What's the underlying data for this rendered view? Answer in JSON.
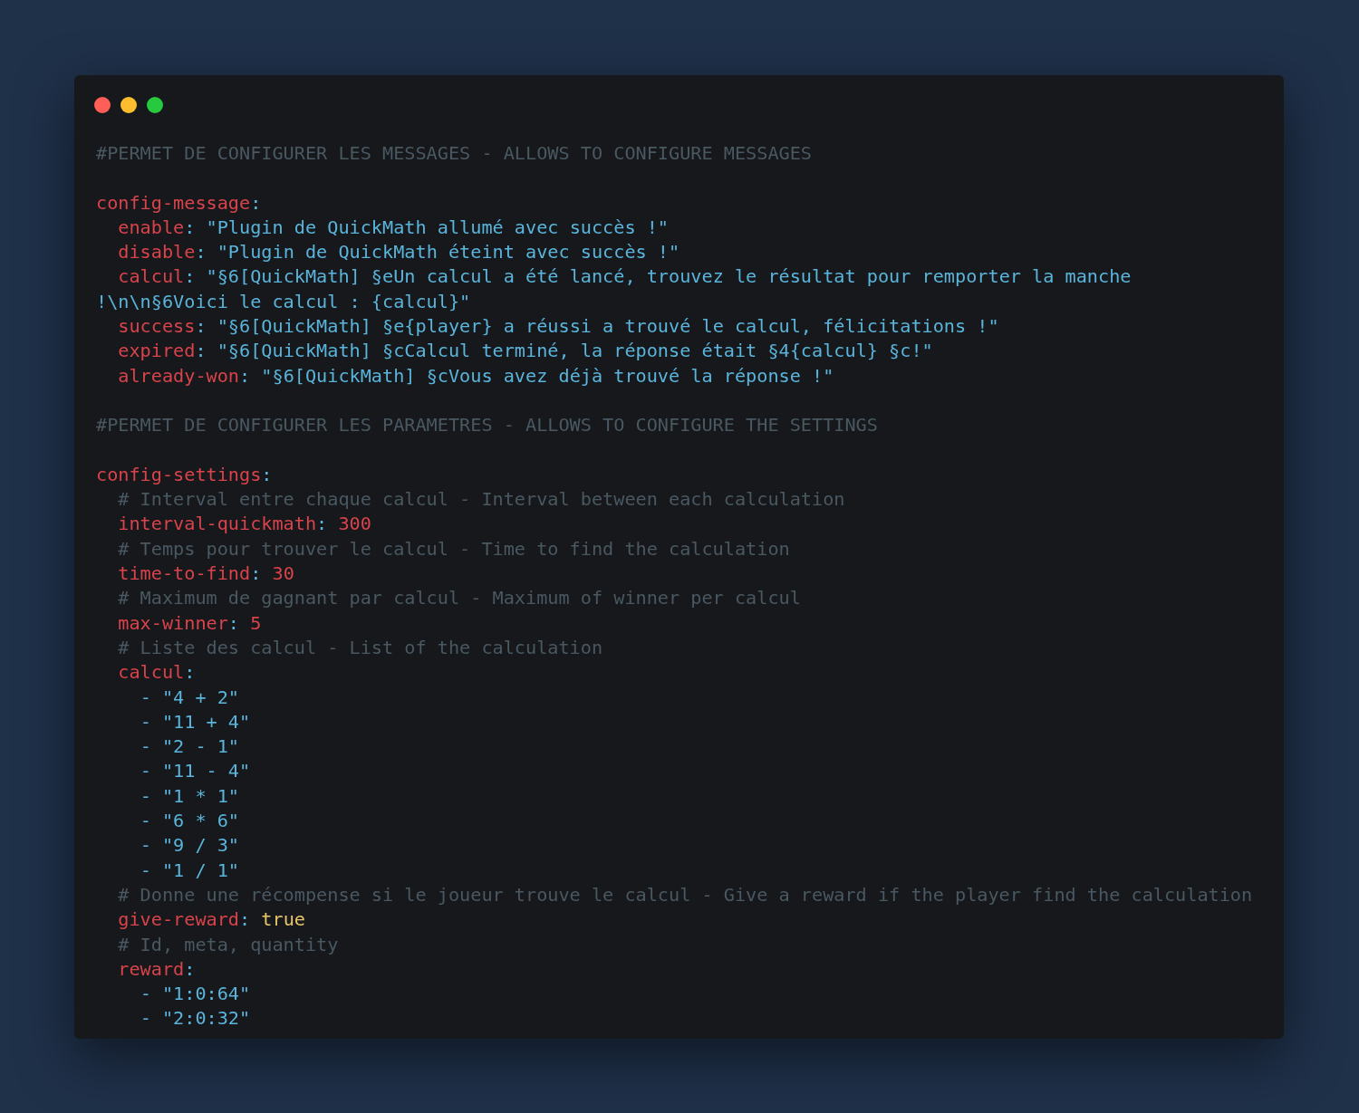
{
  "window": {
    "controls": [
      {
        "color": "#ff5f56"
      },
      {
        "color": "#ffbd2e"
      },
      {
        "color": "#27c93f"
      }
    ]
  },
  "editor": {
    "lines": [
      {
        "kind": "code",
        "tokens": [
          {
            "kind": "comment",
            "text": "#PERMET DE CONFIGURER LES MESSAGES - ALLOWS TO CONFIGURE MESSAGES"
          }
        ]
      },
      {
        "kind": "blank"
      },
      {
        "kind": "code",
        "tokens": [
          {
            "kind": "key",
            "text": "config-message"
          },
          {
            "kind": "punct",
            "text": ":"
          }
        ]
      },
      {
        "kind": "code",
        "tokens": [
          {
            "kind": "key",
            "text": "  enable"
          },
          {
            "kind": "punct",
            "text": ": "
          },
          {
            "kind": "string",
            "text": "\"Plugin de QuickMath allumé avec succès !\""
          }
        ]
      },
      {
        "kind": "code",
        "tokens": [
          {
            "kind": "key",
            "text": "  disable"
          },
          {
            "kind": "punct",
            "text": ": "
          },
          {
            "kind": "string",
            "text": "\"Plugin de QuickMath éteint avec succès !\""
          }
        ]
      },
      {
        "kind": "code",
        "tokens": [
          {
            "kind": "key",
            "text": "  calcul"
          },
          {
            "kind": "punct",
            "text": ": "
          },
          {
            "kind": "string",
            "text": "\"§6[QuickMath] §eUn calcul a été lancé, trouvez le résultat pour remporter la manche"
          }
        ]
      },
      {
        "kind": "code",
        "tokens": [
          {
            "kind": "string",
            "text": "!\\n\\n§6Voici le calcul : {calcul}\""
          }
        ]
      },
      {
        "kind": "code",
        "tokens": [
          {
            "kind": "key",
            "text": "  success"
          },
          {
            "kind": "punct",
            "text": ": "
          },
          {
            "kind": "string",
            "text": "\"§6[QuickMath] §e{player} a réussi a trouvé le calcul, félicitations !\""
          }
        ]
      },
      {
        "kind": "code",
        "tokens": [
          {
            "kind": "key",
            "text": "  expired"
          },
          {
            "kind": "punct",
            "text": ": "
          },
          {
            "kind": "string",
            "text": "\"§6[QuickMath] §cCalcul terminé, la réponse était §4{calcul} §c!\""
          }
        ]
      },
      {
        "kind": "code",
        "tokens": [
          {
            "kind": "key",
            "text": "  already-won"
          },
          {
            "kind": "punct",
            "text": ": "
          },
          {
            "kind": "string",
            "text": "\"§6[QuickMath] §cVous avez déjà trouvé la réponse !\""
          }
        ]
      },
      {
        "kind": "blank"
      },
      {
        "kind": "code",
        "tokens": [
          {
            "kind": "comment",
            "text": "#PERMET DE CONFIGURER LES PARAMETRES - ALLOWS TO CONFIGURE THE SETTINGS"
          }
        ]
      },
      {
        "kind": "blank"
      },
      {
        "kind": "code",
        "tokens": [
          {
            "kind": "key",
            "text": "config-settings"
          },
          {
            "kind": "punct",
            "text": ":"
          }
        ]
      },
      {
        "kind": "code",
        "tokens": [
          {
            "kind": "comment",
            "text": "  # Interval entre chaque calcul - Interval between each calculation"
          }
        ]
      },
      {
        "kind": "code",
        "tokens": [
          {
            "kind": "key",
            "text": "  interval-quickmath"
          },
          {
            "kind": "punct",
            "text": ": "
          },
          {
            "kind": "number",
            "text": "300"
          }
        ]
      },
      {
        "kind": "code",
        "tokens": [
          {
            "kind": "comment",
            "text": "  # Temps pour trouver le calcul - Time to find the calculation"
          }
        ]
      },
      {
        "kind": "code",
        "tokens": [
          {
            "kind": "key",
            "text": "  time-to-find"
          },
          {
            "kind": "punct",
            "text": ": "
          },
          {
            "kind": "number",
            "text": "30"
          }
        ]
      },
      {
        "kind": "code",
        "tokens": [
          {
            "kind": "comment",
            "text": "  # Maximum de gagnant par calcul - Maximum of winner per calcul"
          }
        ]
      },
      {
        "kind": "code",
        "tokens": [
          {
            "kind": "key",
            "text": "  max-winner"
          },
          {
            "kind": "punct",
            "text": ": "
          },
          {
            "kind": "number",
            "text": "5"
          }
        ]
      },
      {
        "kind": "code",
        "tokens": [
          {
            "kind": "comment",
            "text": "  # Liste des calcul - List of the calculation"
          }
        ]
      },
      {
        "kind": "code",
        "tokens": [
          {
            "kind": "key",
            "text": "  calcul"
          },
          {
            "kind": "punct",
            "text": ":"
          }
        ]
      },
      {
        "kind": "code",
        "tokens": [
          {
            "kind": "punct",
            "text": "    - "
          },
          {
            "kind": "string",
            "text": "\"4 + 2\""
          }
        ]
      },
      {
        "kind": "code",
        "tokens": [
          {
            "kind": "punct",
            "text": "    - "
          },
          {
            "kind": "string",
            "text": "\"11 + 4\""
          }
        ]
      },
      {
        "kind": "code",
        "tokens": [
          {
            "kind": "punct",
            "text": "    - "
          },
          {
            "kind": "string",
            "text": "\"2 - 1\""
          }
        ]
      },
      {
        "kind": "code",
        "tokens": [
          {
            "kind": "punct",
            "text": "    - "
          },
          {
            "kind": "string",
            "text": "\"11 - 4\""
          }
        ]
      },
      {
        "kind": "code",
        "tokens": [
          {
            "kind": "punct",
            "text": "    - "
          },
          {
            "kind": "string",
            "text": "\"1 * 1\""
          }
        ]
      },
      {
        "kind": "code",
        "tokens": [
          {
            "kind": "punct",
            "text": "    - "
          },
          {
            "kind": "string",
            "text": "\"6 * 6\""
          }
        ]
      },
      {
        "kind": "code",
        "tokens": [
          {
            "kind": "punct",
            "text": "    - "
          },
          {
            "kind": "string",
            "text": "\"9 / 3\""
          }
        ]
      },
      {
        "kind": "code",
        "tokens": [
          {
            "kind": "punct",
            "text": "    - "
          },
          {
            "kind": "string",
            "text": "\"1 / 1\""
          }
        ]
      },
      {
        "kind": "code",
        "tokens": [
          {
            "kind": "comment",
            "text": "  # Donne une récompense si le joueur trouve le calcul - Give a reward if the player find the calculation"
          }
        ]
      },
      {
        "kind": "code",
        "tokens": [
          {
            "kind": "key",
            "text": "  give-reward"
          },
          {
            "kind": "punct",
            "text": ": "
          },
          {
            "kind": "bool",
            "text": "true"
          }
        ]
      },
      {
        "kind": "code",
        "tokens": [
          {
            "kind": "comment",
            "text": "  # Id, meta, quantity"
          }
        ]
      },
      {
        "kind": "code",
        "tokens": [
          {
            "kind": "key",
            "text": "  reward"
          },
          {
            "kind": "punct",
            "text": ":"
          }
        ]
      },
      {
        "kind": "code",
        "tokens": [
          {
            "kind": "punct",
            "text": "    - "
          },
          {
            "kind": "string",
            "text": "\"1:0:64\""
          }
        ]
      },
      {
        "kind": "code",
        "tokens": [
          {
            "kind": "punct",
            "text": "    - "
          },
          {
            "kind": "string",
            "text": "\"2:0:32\""
          }
        ]
      }
    ]
  }
}
